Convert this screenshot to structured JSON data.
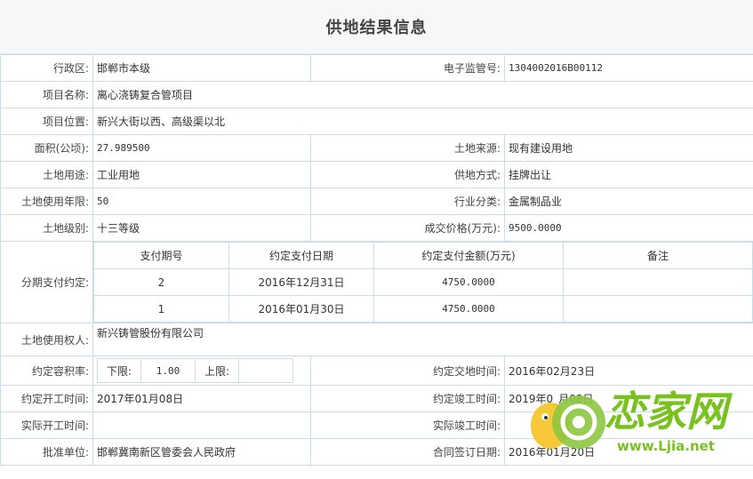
{
  "title": "供地结果信息",
  "rows": {
    "district": {
      "label": "行政区:",
      "value": "邯郸市本级"
    },
    "supervision_no": {
      "label": "电子监管号:",
      "value": "1304002016B00112"
    },
    "project_name": {
      "label": "项目名称:",
      "value": "离心浇铸复合管项目"
    },
    "location": {
      "label": "项目位置:",
      "value": "新兴大街以西、高级渠以北"
    },
    "area": {
      "label": "面积(公顷):",
      "value": "27.989500"
    },
    "land_source": {
      "label": "土地来源:",
      "value": "现有建设用地"
    },
    "land_use": {
      "label": "土地用途:",
      "value": "工业用地"
    },
    "supply_method": {
      "label": "供地方式:",
      "value": "挂牌出让"
    },
    "use_term": {
      "label": "土地使用年限:",
      "value": "50"
    },
    "industry": {
      "label": "行业分类:",
      "value": "金属制品业"
    },
    "land_grade": {
      "label": "土地级别:",
      "value": "十三等级"
    },
    "deal_price": {
      "label": "成交价格(万元):",
      "value": "9500.0000"
    },
    "installment": {
      "label": "分期支付约定:"
    },
    "holder": {
      "label": "土地使用权人:",
      "value": "新兴铸管股份有限公司"
    },
    "far": {
      "label": "约定容积率:",
      "lower_label": "下限:",
      "lower_value": "1.00",
      "upper_label": "上限:",
      "upper_value": ""
    },
    "handover_date": {
      "label": "约定交地时间:",
      "value": "2016年02月23日"
    },
    "start_date": {
      "label": "约定开工时间:",
      "value": "2017年01月08日"
    },
    "completion_date": {
      "label": "约定竣工时间:",
      "value": "2019年0_月08日"
    },
    "actual_start": {
      "label": "实际开工时间:",
      "value": ""
    },
    "actual_completion": {
      "label": "实际竣工时间:",
      "value": ""
    },
    "approver": {
      "label": "批准单位:",
      "value": "邯郸冀南新区管委会人民政府"
    },
    "contract_date": {
      "label": "合同签订日期:",
      "value": "2016年01月20日"
    }
  },
  "payment_table": {
    "headers": [
      "支付期号",
      "约定支付日期",
      "约定支付金额(万元)",
      "备注"
    ],
    "rows": [
      {
        "period": "2",
        "date": "2016年12月31日",
        "amount": "4750.0000",
        "note": ""
      },
      {
        "period": "1",
        "date": "2016年01月30日",
        "amount": "4750.0000",
        "note": ""
      }
    ]
  },
  "watermark": {
    "brand": "恋家网",
    "url": "www.Ljia.net",
    "colors": {
      "green": "#79c11f",
      "snail_shell": "#8dc63f",
      "snail_body": "#f6c324"
    }
  }
}
